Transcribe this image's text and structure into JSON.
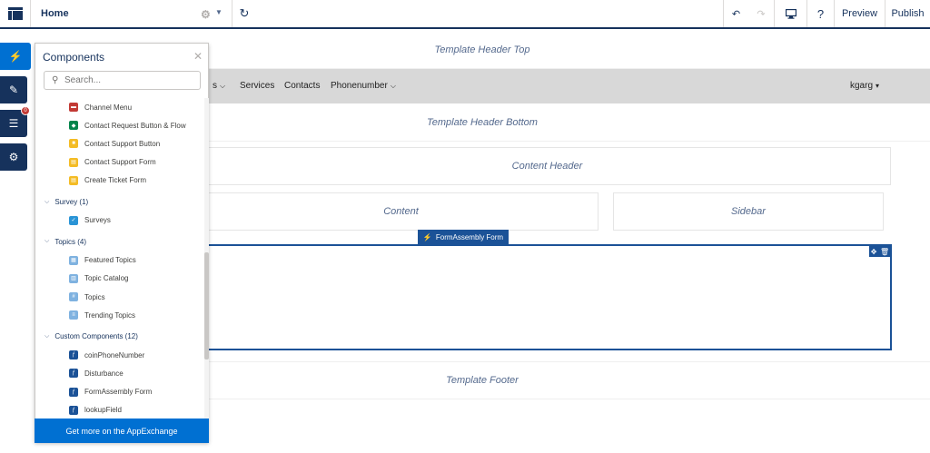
{
  "topbar": {
    "page_name": "Home",
    "preview_label": "Preview",
    "publish_label": "Publish",
    "help_label": "?"
  },
  "canvas": {
    "template_header_top": "Template Header Top",
    "template_header_bottom": "Template Header Bottom",
    "content_header": "Content Header",
    "content": "Content",
    "sidebar": "Sidebar",
    "template_footer": "Template Footer",
    "selected_component_label": "FormAssembly Form",
    "nav": {
      "items": [
        "Services",
        "Contacts",
        "Phonenumber"
      ],
      "partial_item_suffix": "s",
      "user_menu": "kgarg"
    }
  },
  "rail": {
    "badge_count": "0"
  },
  "panel": {
    "title": "Components",
    "search_placeholder": "Search...",
    "footer_link": "Get more on the AppExchange",
    "items": [
      {
        "label": "Channel Menu",
        "color": "#c23934",
        "icon": "menu-icon"
      },
      {
        "label": "Contact Request Button & Flow",
        "color": "#04844b",
        "icon": "flow-icon"
      },
      {
        "label": "Contact Support Button",
        "color": "#f4bc25",
        "icon": "button-icon"
      },
      {
        "label": "Contact Support Form",
        "color": "#f4bc25",
        "icon": "form-icon"
      },
      {
        "label": "Create Ticket Form",
        "color": "#f4bc25",
        "icon": "form-icon"
      }
    ],
    "groups": [
      {
        "label": "Survey (1)",
        "items": [
          {
            "label": "Surveys",
            "color": "#2a94d6",
            "icon": "survey-icon"
          }
        ]
      },
      {
        "label": "Topics (4)",
        "items": [
          {
            "label": "Featured Topics",
            "color": "#7fb2e0",
            "icon": "grid-icon"
          },
          {
            "label": "Topic Catalog",
            "color": "#7fb2e0",
            "icon": "catalog-icon"
          },
          {
            "label": "Topics",
            "color": "#7fb2e0",
            "icon": "hash-icon"
          },
          {
            "label": "Trending Topics",
            "color": "#7fb2e0",
            "icon": "list-icon"
          }
        ]
      },
      {
        "label": "Custom Components (12)",
        "items": [
          {
            "label": "coinPhoneNumber",
            "color": "#1b5297",
            "icon": "function-icon"
          },
          {
            "label": "Disturbance",
            "color": "#1b5297",
            "icon": "function-icon"
          },
          {
            "label": "FormAssembly Form",
            "color": "#1b5297",
            "icon": "function-icon"
          },
          {
            "label": "lookupField",
            "color": "#1b5297",
            "icon": "function-icon"
          }
        ]
      }
    ]
  },
  "colors": {
    "brand_blue": "#0070d2",
    "navy": "#16325c",
    "selection_blue": "#1b5297",
    "nav_bg": "#d8d8d8"
  }
}
